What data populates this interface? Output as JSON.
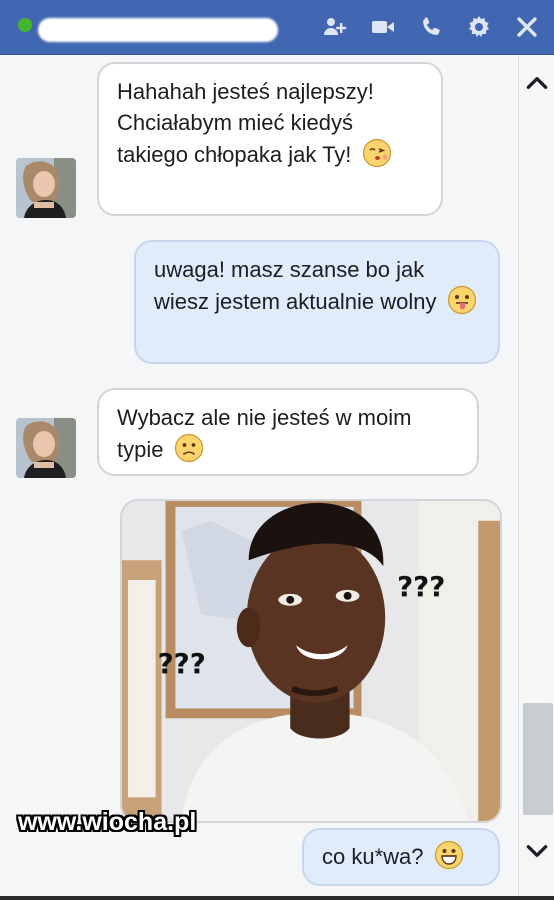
{
  "titlebar": {
    "online_status": "online",
    "icons": [
      "add-person-icon",
      "video-call-icon",
      "phone-call-icon",
      "gear-icon",
      "close-icon"
    ]
  },
  "messages": [
    {
      "sender": "them",
      "text": "Hahahah jesteś najlepszy! Chciałabym mieć kiedyś takiego chłopaka jak Ty!",
      "emoji": "kiss-emoji-icon"
    },
    {
      "sender": "me",
      "text": "uwaga! masz szanse bo jak wiesz jestem aktualnie wolny",
      "emoji": "tongue-emoji-icon"
    },
    {
      "sender": "them",
      "text": "Wybacz ale nie jesteś w moim typie",
      "emoji": "frown-emoji-icon"
    },
    {
      "sender": "me",
      "type": "image",
      "image_text": [
        "???",
        "???"
      ]
    },
    {
      "sender": "me",
      "text": "co ku*wa?",
      "emoji": "grin-emoji-icon"
    }
  ],
  "watermark": "www.wiocha.pl",
  "colors": {
    "header": "#4267b2",
    "outgoing_bubble": "#e1ecfb",
    "incoming_bubble": "#ffffff",
    "online": "#42b72a"
  }
}
